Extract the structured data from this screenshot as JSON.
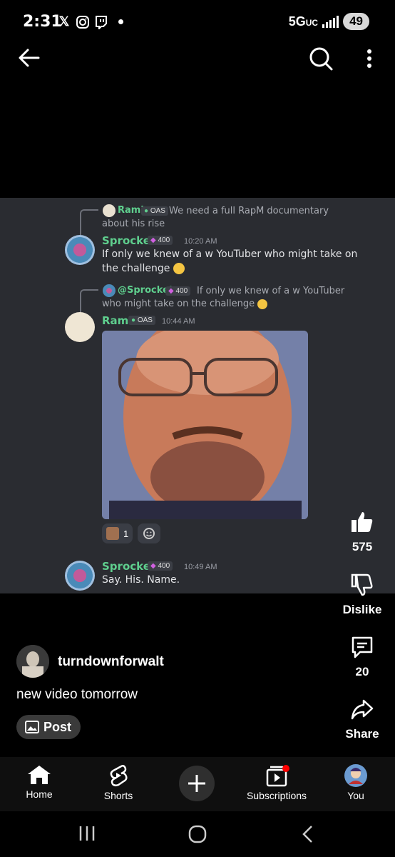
{
  "status_bar": {
    "time": "2:31",
    "network": "5G",
    "network_sub": "UC",
    "battery": "49"
  },
  "video": {
    "reply1": {
      "name": "Rami",
      "tag": "OAS",
      "text_line1": "We need a full RapM documentary",
      "text_line2": "about his rise"
    },
    "msg1": {
      "name": "Sprocket",
      "tag": "400",
      "time": "10:20 AM",
      "text_line1": "If only we knew of a w YouTuber who might take on",
      "text_line2": "the challenge"
    },
    "reply2": {
      "name": "@Sprocket",
      "tag": "400",
      "text_line1": "If only we knew of a w YouTuber",
      "text_line2": "who might take on the challenge"
    },
    "msg2": {
      "name": "Rami",
      "tag": "OAS",
      "time": "10:44 AM"
    },
    "reaction_count": "1",
    "msg3": {
      "name": "Sprocket",
      "tag": "400",
      "time": "10:49 AM",
      "text": "Say. His. Name."
    }
  },
  "actions": {
    "like_count": "575",
    "dislike_label": "Dislike",
    "comment_count": "20",
    "share_label": "Share"
  },
  "channel": {
    "name": "turndownforwalt",
    "caption": "new video tomorrow",
    "post_label": "Post"
  },
  "bottom_nav": {
    "home": "Home",
    "shorts": "Shorts",
    "subscriptions": "Subscriptions",
    "you": "You"
  },
  "colors": {
    "discord_bg": "#2a2c31",
    "name_green": "#5fcf8e",
    "notification_red": "#ff0000"
  }
}
